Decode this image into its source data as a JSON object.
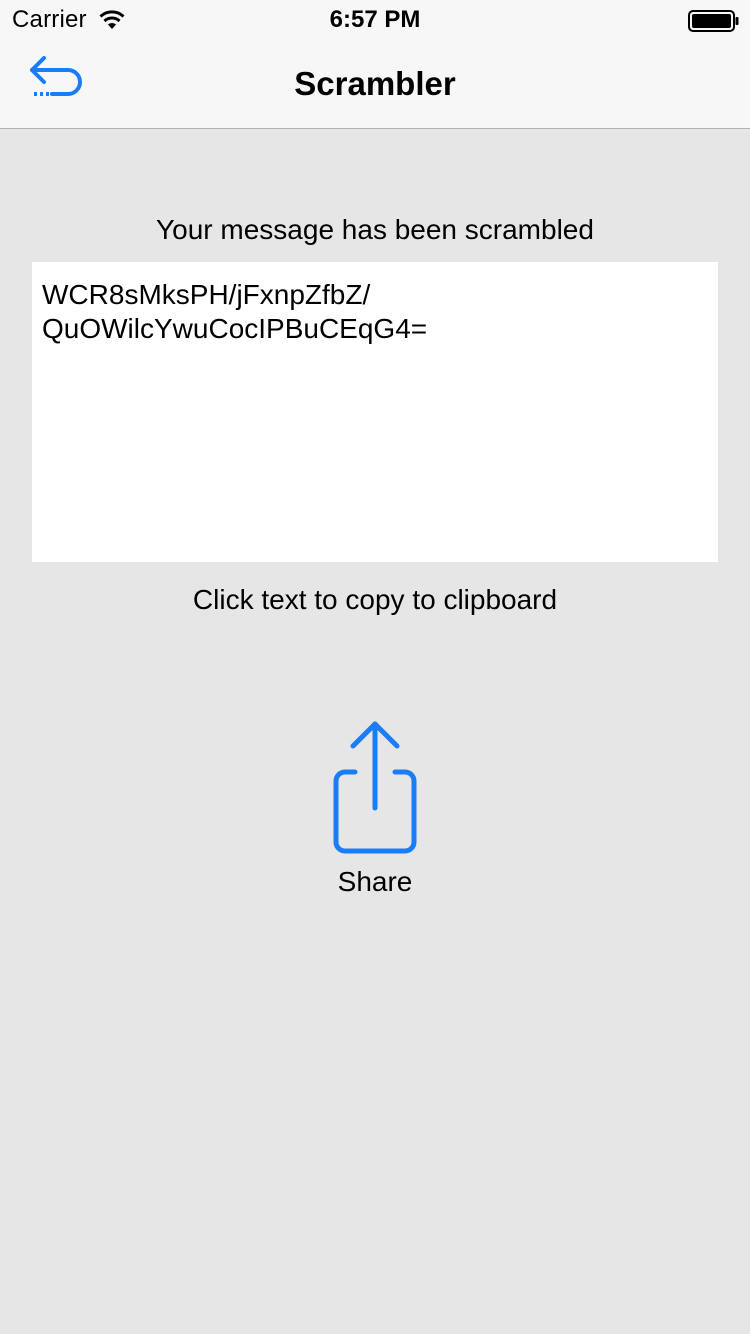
{
  "status_bar": {
    "carrier": "Carrier",
    "time": "6:57 PM",
    "wifi_icon": "wifi-icon",
    "battery_icon": "battery-full-icon"
  },
  "nav_bar": {
    "title": "Scrambler",
    "back_icon": "undo-arrow-icon"
  },
  "content": {
    "heading": "Your message has been scrambled",
    "scrambled_text": "WCR8sMksPH/jFxnpZfbZ/\nQuOWilcYwuCocIPBuCEqG4=",
    "copy_hint": "Click text to copy to clipboard",
    "share": {
      "label": "Share",
      "icon": "share-icon"
    }
  },
  "colors": {
    "accent": "#1a7df5",
    "background": "#e6e6e6",
    "header_background": "#f7f7f7",
    "text_box_background": "#ffffff"
  }
}
